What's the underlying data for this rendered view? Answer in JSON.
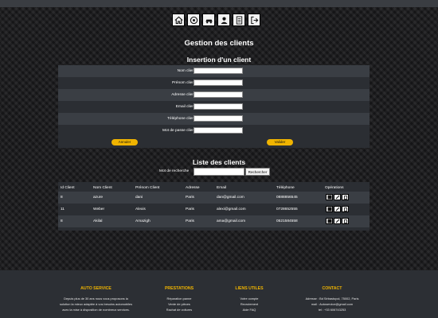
{
  "nav": {
    "icons": [
      "home-icon",
      "car-icon",
      "garage-icon",
      "user-icon",
      "document-icon",
      "logout-icon"
    ]
  },
  "page_title": "Gestion des clients",
  "insert": {
    "title": "Insertion d'un client",
    "fields": [
      {
        "label": "Nom client :",
        "value": ""
      },
      {
        "label": "Prénom client :",
        "value": ""
      },
      {
        "label": "Adresse client :",
        "value": ""
      },
      {
        "label": "Email client :",
        "value": ""
      },
      {
        "label": "Téléphone client :",
        "value": ""
      },
      {
        "label": "Mot de passe client :",
        "value": ""
      }
    ],
    "cancel_label": "Annuler",
    "submit_label": "Valider"
  },
  "list": {
    "title": "Liste des clients",
    "search_label": "Mot de recherche",
    "search_value": "",
    "search_button": "Rechercher",
    "columns": [
      "Id Client",
      "Nom Client",
      "Prénom Client",
      "Adresse",
      "Email",
      "Téléphone",
      "Opérations"
    ],
    "rows": [
      [
        "8",
        "azure",
        "dani",
        "Paris",
        "dan@gmail.com",
        "0888856545"
      ],
      [
        "11",
        "Weber",
        "Alexis",
        "Paris",
        "alexi@gmail.com",
        "0728652555"
      ],
      [
        "8",
        "Akilal",
        "Amazigh",
        "Paris",
        "ama@gmail.com",
        "0521584558"
      ]
    ],
    "operation_icons": [
      "view-icon",
      "edit-icon",
      "delete-icon"
    ]
  },
  "footer": {
    "col1": {
      "title": "AUTO SERVICE",
      "lines": [
        "Depuis plus de 30 ans nous vous proposons la",
        "solution la mieux adaptée à vos besoins automobiles",
        "avec la mise à disposition de nombreux services."
      ]
    },
    "col2": {
      "title": "PRESTATIONS",
      "lines": [
        "Réparation panne",
        "Vente de pièces",
        "Rachat de voitures"
      ]
    },
    "col3": {
      "title": "LIENS UTILES",
      "lines": [
        "Votre compte",
        "Recrutement",
        "Aide FAQ"
      ]
    },
    "col4": {
      "title": "CONTACT",
      "lines": [
        "Adresse : Bd Sébastopol, 75002, Paris",
        "mail : Autoservice@gmail.com",
        "tel : +33 606743253"
      ]
    }
  },
  "colors": {
    "accent": "#f0b400",
    "panel": "#2b2e33",
    "panel_alt": "#3a3e44",
    "footer": "#2c2f34"
  }
}
